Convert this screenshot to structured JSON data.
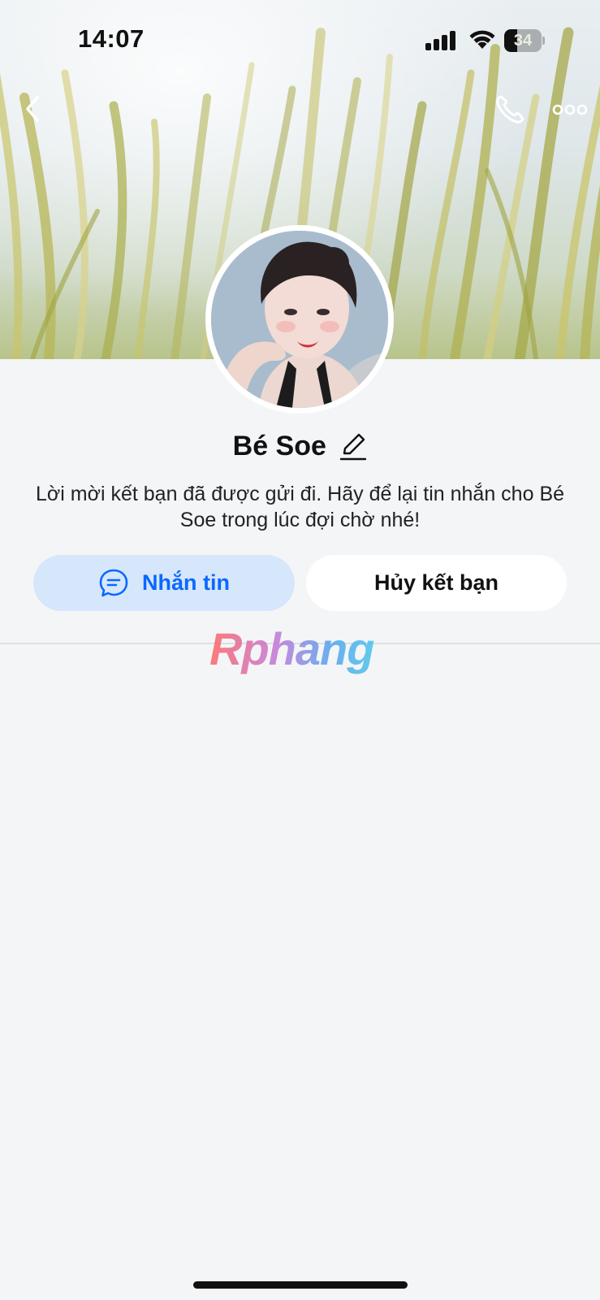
{
  "status_bar": {
    "time": "14:07",
    "battery_level": "34",
    "battery_fraction": 0.34
  },
  "header": {
    "back_icon": "chevron-left-icon",
    "call_icon": "phone-icon",
    "more_icon": "more-horizontal-icon"
  },
  "profile": {
    "name": "Bé Soe",
    "edit_icon": "pencil-icon",
    "info_message": "Lời mời kết bạn đã được gửi đi. Hãy để lại tin nhắn cho Bé Soe trong lúc đợi chờ nhé!"
  },
  "actions": {
    "message_label": "Nhắn tin",
    "message_icon": "chat-bubble-icon",
    "cancel_label": "Hủy kết bạn"
  },
  "watermark": {
    "text": "Rphang"
  },
  "colors": {
    "accent": "#0a68ff",
    "message_button_bg": "#d6e6fb",
    "page_bg": "#f4f5f7"
  }
}
